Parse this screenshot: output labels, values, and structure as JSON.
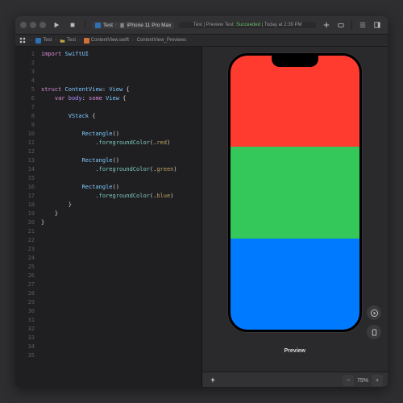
{
  "toolbar": {
    "scheme": "Test",
    "device": "iPhone 11 Pro Max",
    "status_prefix": "Test | Preview Test: ",
    "status_result": "Succeeded",
    "status_time": " | Today at 2:39 PM"
  },
  "jumpbar": [
    "Test",
    "Test",
    "ContentView.swift",
    "ContentView_Previews"
  ],
  "code": {
    "line_count": 35,
    "tokens": [
      [
        [
          "kw",
          "import"
        ],
        [
          "id",
          " "
        ],
        [
          "ty",
          "SwiftUI"
        ]
      ],
      [],
      [],
      [],
      [
        [
          "kw",
          "struct"
        ],
        [
          "id",
          " "
        ],
        [
          "ty",
          "ContentView"
        ],
        [
          "id",
          ": "
        ],
        [
          "ty",
          "View"
        ],
        [
          "id",
          " {"
        ]
      ],
      [
        [
          "id",
          "    "
        ],
        [
          "kw",
          "var"
        ],
        [
          "id",
          " "
        ],
        [
          "pr",
          "body"
        ],
        [
          "id",
          ": "
        ],
        [
          "kw",
          "some"
        ],
        [
          "id",
          " "
        ],
        [
          "ty",
          "View"
        ],
        [
          "id",
          " {"
        ]
      ],
      [],
      [
        [
          "id",
          "        "
        ],
        [
          "ty",
          "VStack"
        ],
        [
          "id",
          " {"
        ]
      ],
      [],
      [
        [
          "id",
          "            "
        ],
        [
          "ty",
          "Rectangle"
        ],
        [
          "id",
          "()"
        ]
      ],
      [
        [
          "id",
          "                ."
        ],
        [
          "fn",
          "foregroundColor"
        ],
        [
          "id",
          "(."
        ],
        [
          "en",
          "red"
        ],
        [
          "id",
          ")"
        ]
      ],
      [],
      [
        [
          "id",
          "            "
        ],
        [
          "ty",
          "Rectangle"
        ],
        [
          "id",
          "()"
        ]
      ],
      [
        [
          "id",
          "                ."
        ],
        [
          "fn",
          "foregroundColor"
        ],
        [
          "id",
          "(."
        ],
        [
          "en",
          "green"
        ],
        [
          "id",
          ")"
        ]
      ],
      [],
      [
        [
          "id",
          "            "
        ],
        [
          "ty",
          "Rectangle"
        ],
        [
          "id",
          "()"
        ]
      ],
      [
        [
          "id",
          "                ."
        ],
        [
          "fn",
          "foregroundColor"
        ],
        [
          "id",
          "(."
        ],
        [
          "en",
          "blue"
        ],
        [
          "id",
          ")"
        ]
      ],
      [
        [
          "id",
          "        }"
        ]
      ],
      [
        [
          "id",
          "    }"
        ]
      ],
      [
        [
          "id",
          "}"
        ]
      ],
      [],
      [],
      [],
      [],
      [],
      [],
      [],
      [],
      [],
      [],
      [],
      [],
      [],
      [],
      []
    ]
  },
  "preview": {
    "label": "Preview",
    "zoom": "75%",
    "rectangles": [
      {
        "name": "red",
        "color": "#ff3b30"
      },
      {
        "name": "green",
        "color": "#34c759"
      },
      {
        "name": "blue",
        "color": "#007aff"
      }
    ]
  }
}
